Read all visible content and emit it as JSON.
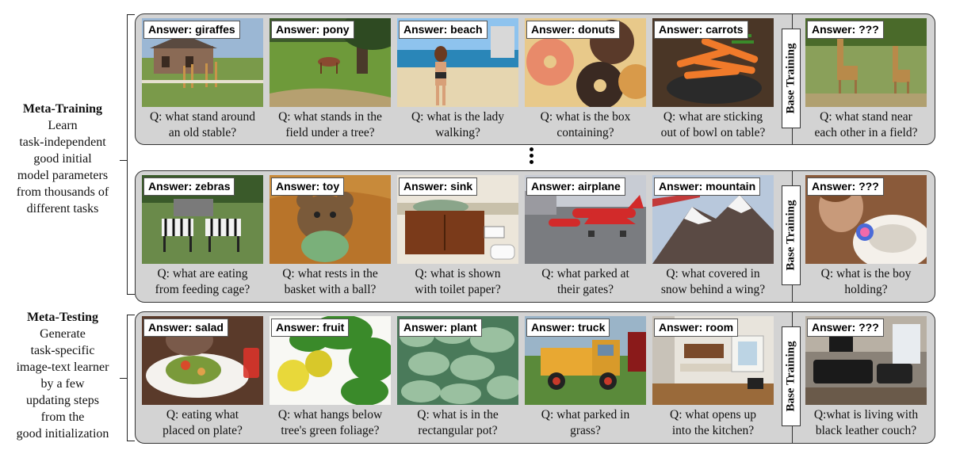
{
  "meta_training": {
    "heading": "Meta-Training",
    "description": "Learn\ntask-independent\ngood initial\nmodel parameters\nfrom thousands of\ndifferent tasks"
  },
  "meta_testing": {
    "heading": "Meta-Testing",
    "description": "Generate\ntask-specific\nimage-text learner\nby a few\nupdating steps\nfrom the\ngood initialization"
  },
  "base_training_label": "Base Training",
  "rows": [
    {
      "support": [
        {
          "answer": "Answer: giraffes",
          "question": "Q: what stand around\nan old stable?",
          "image": "giraffes-near-stable"
        },
        {
          "answer": "Answer: pony",
          "question": "Q: what stands in the\nfield under a tree?",
          "image": "pony-in-field"
        },
        {
          "answer": "Answer: beach",
          "question": "Q: what is the lady\nwalking?",
          "image": "woman-on-beach"
        },
        {
          "answer": "Answer: donuts",
          "question": "Q: what is the box\ncontaining?",
          "image": "box-of-donuts"
        },
        {
          "answer": "Answer: carrots",
          "question": "Q: what are sticking\nout of bowl on table?",
          "image": "carrots-in-bowl"
        }
      ],
      "query": {
        "answer": "Answer: ???",
        "question": "Q: what stand near\neach other in a field?",
        "image": "giraffes-in-field"
      }
    },
    {
      "support": [
        {
          "answer": "Answer: zebras",
          "question": "Q: what are eating\nfrom feeding cage?",
          "image": "zebras-feeding"
        },
        {
          "answer": "Answer: toy",
          "question": "Q: what rests in the\nbasket with a ball?",
          "image": "toy-in-basket"
        },
        {
          "answer": "Answer: sink",
          "question": "Q: what is shown\nwith toilet paper?",
          "image": "bathroom-sink"
        },
        {
          "answer": "Answer: airplane",
          "question": "Q: what parked at\ntheir gates?",
          "image": "airplanes-at-gates"
        },
        {
          "answer": "Answer: mountain",
          "question": "Q: what covered in\nsnow behind a wing?",
          "image": "snowy-mountain"
        }
      ],
      "query": {
        "answer": "Answer: ???",
        "question": "Q: what is the boy\nholding?",
        "image": "boy-holding-ball"
      }
    },
    {
      "support": [
        {
          "answer": "Answer: salad",
          "question": "Q: eating what\nplaced on plate?",
          "image": "salad-on-plate"
        },
        {
          "answer": "Answer: fruit",
          "question": "Q: what hangs below\ntree's green foliage?",
          "image": "fruit-on-tree"
        },
        {
          "answer": "Answer: plant",
          "question": "Q: what is in the\nrectangular pot?",
          "image": "plant-in-pot"
        },
        {
          "answer": "Answer: truck",
          "question": "Q: what parked in\ngrass?",
          "image": "old-truck"
        },
        {
          "answer": "Answer: room",
          "question": "Q: what opens up\ninto the kitchen?",
          "image": "open-room"
        }
      ],
      "query": {
        "answer": "Answer: ???",
        "question": "Q:what is living with\nblack leather couch?",
        "image": "living-room"
      }
    }
  ]
}
